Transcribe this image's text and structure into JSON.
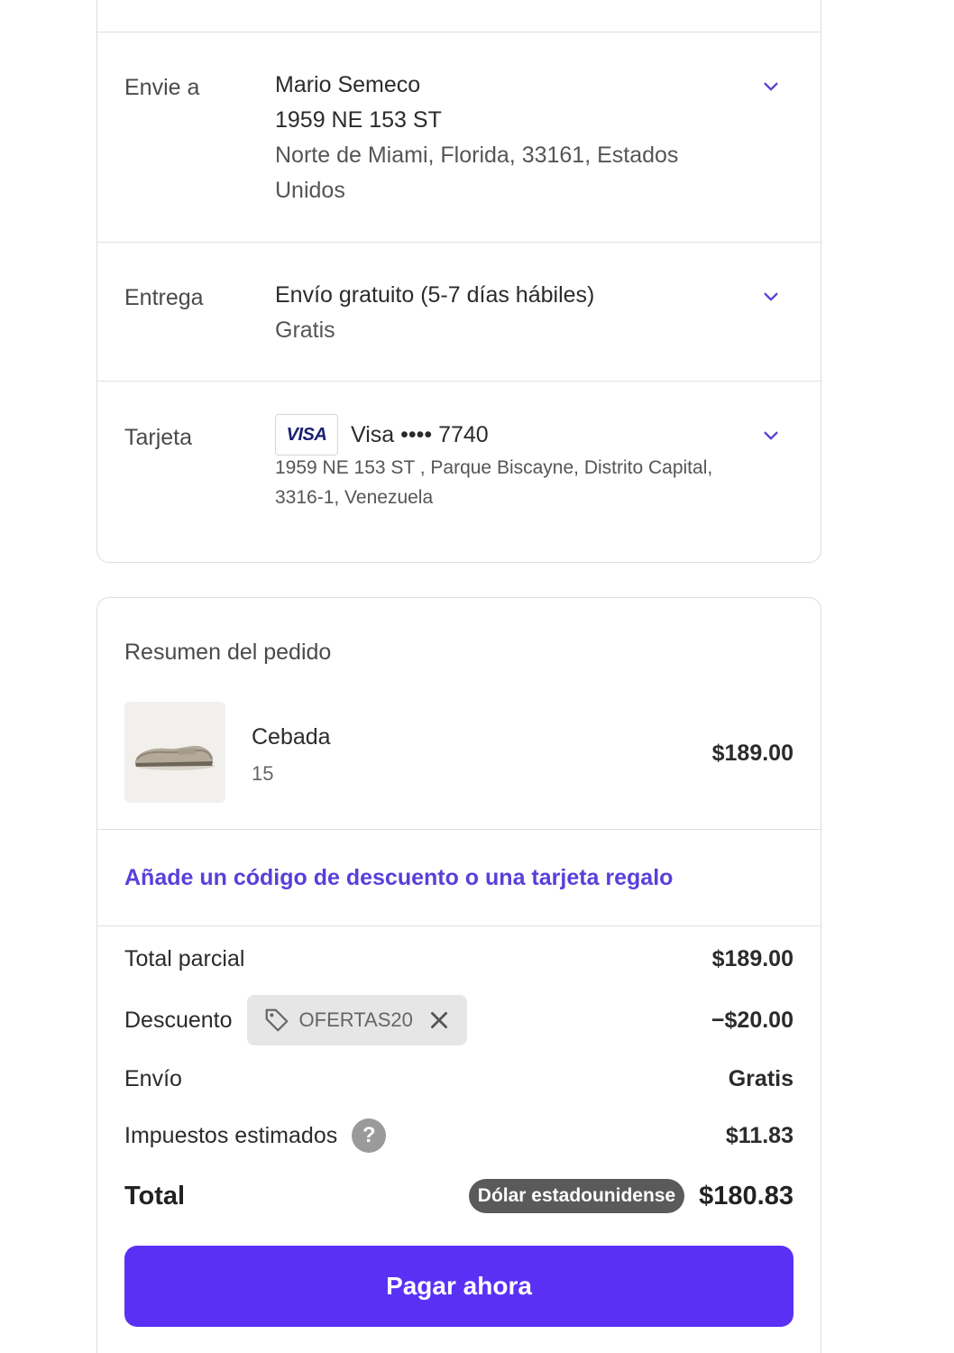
{
  "shipping": {
    "label": "Envie a",
    "name": "Mario Semeco",
    "address_line1": "1959 NE 153 ST",
    "address_line2": "Norte de Miami, Florida, 33161, Estados",
    "address_line3": "Unidos"
  },
  "delivery": {
    "label": "Entrega",
    "method": "Envío gratuito (5-7 días hábiles)",
    "price": "Gratis"
  },
  "card": {
    "label": "Tarjeta",
    "brand_logo": "VISA",
    "description": "Visa •••• 7740",
    "billing_line1": "1959 NE 153 ST , Parque Biscayne, Distrito Capital,",
    "billing_line2": "3316-1, Venezuela"
  },
  "summary": {
    "title": "Resumen del pedido",
    "product": {
      "name": "Cebada",
      "variant": "15",
      "price": "$189.00",
      "image_icon": "loafer-shoe-image"
    },
    "discount_link": "Añade un código de descuento o una tarjeta regalo",
    "subtotal_label": "Total parcial",
    "subtotal_value": "$189.00",
    "discount_label": "Descuento",
    "discount_code": "OFERTAS20",
    "discount_value": "−$20.00",
    "shipping_label": "Envío",
    "shipping_value": "Gratis",
    "taxes_label": "Impuestos estimados",
    "taxes_help": "?",
    "taxes_value": "$11.83",
    "total_label": "Total",
    "currency": "Dólar estadounidense",
    "total_value": "$180.83",
    "pay_button": "Pagar ahora"
  },
  "colors": {
    "accent": "#5a31f4",
    "link": "#5a3fd9",
    "chevron": "#5a3fd9"
  }
}
